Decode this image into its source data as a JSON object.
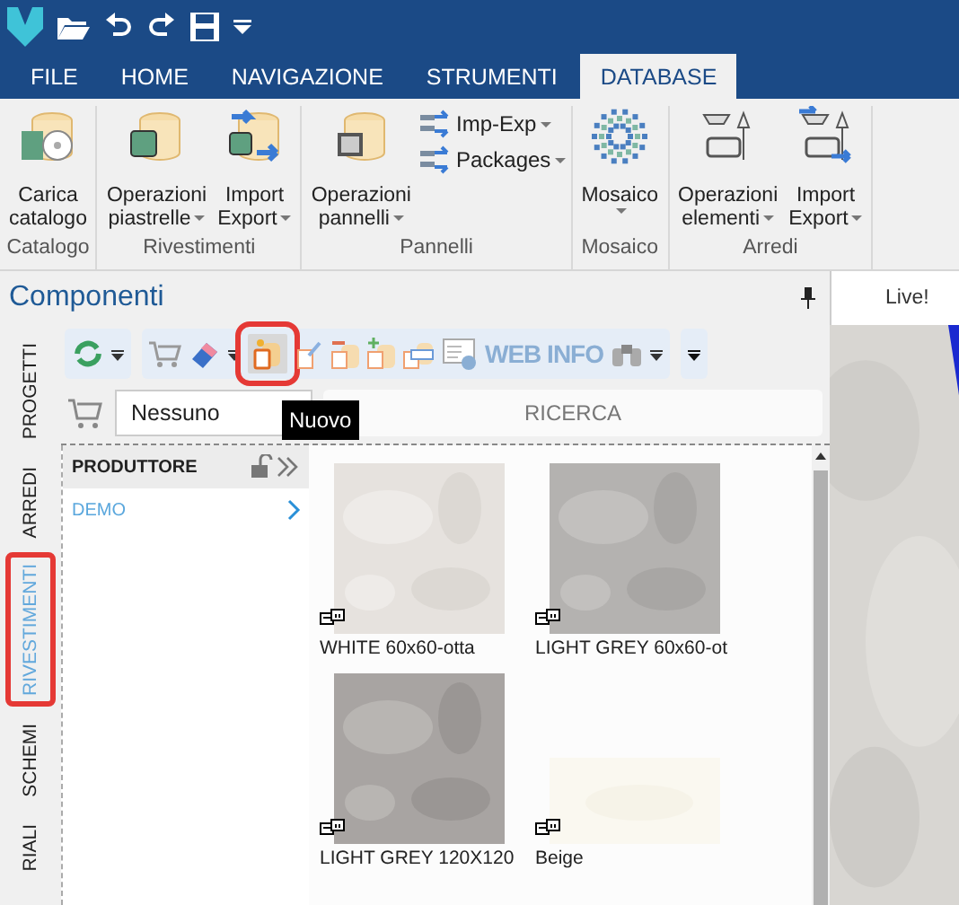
{
  "ribbon_tabs": [
    {
      "label": "FILE",
      "selected": false
    },
    {
      "label": "HOME",
      "selected": false
    },
    {
      "label": "NAVIGAZIONE",
      "selected": false
    },
    {
      "label": "STRUMENTI",
      "selected": false
    },
    {
      "label": "DATABASE",
      "selected": true
    }
  ],
  "ribbon_groups": [
    {
      "label": "Catalogo",
      "items": [
        {
          "kind": "large",
          "lines": [
            "Carica",
            "catalogo"
          ],
          "dropdown": false
        }
      ]
    },
    {
      "label": "Rivestimenti",
      "items": [
        {
          "kind": "large",
          "lines": [
            "Operazioni",
            "piastrelle"
          ],
          "dropdown": true
        },
        {
          "kind": "large",
          "lines": [
            "Import",
            "Export"
          ],
          "dropdown": true
        }
      ]
    },
    {
      "label": "Pannelli",
      "items": [
        {
          "kind": "large",
          "lines": [
            "Operazioni",
            "pannelli"
          ],
          "dropdown": true
        },
        {
          "kind": "small",
          "lines": [
            "Imp-Exp"
          ],
          "dropdown": true
        },
        {
          "kind": "small",
          "lines": [
            "Packages"
          ],
          "dropdown": true
        }
      ]
    },
    {
      "label": "Mosaico",
      "items": [
        {
          "kind": "large",
          "lines": [
            "Mosaico"
          ],
          "dropdown": true
        }
      ]
    },
    {
      "label": "Arredi",
      "items": [
        {
          "kind": "large",
          "lines": [
            "Operazioni",
            "elementi"
          ],
          "dropdown": true
        },
        {
          "kind": "large",
          "lines": [
            "Import",
            "Export"
          ],
          "dropdown": true
        }
      ]
    }
  ],
  "panel": {
    "title": "Componenti",
    "side_tabs": [
      {
        "label": "PROGETTI",
        "selected": false,
        "highlighted": false
      },
      {
        "label": "ARREDI",
        "selected": false,
        "highlighted": false
      },
      {
        "label": "RIVESTIMENTI",
        "selected": true,
        "highlighted": true
      },
      {
        "label": "SCHEMI",
        "selected": false,
        "highlighted": false
      },
      {
        "label": "RIALI",
        "selected": false,
        "highlighted": false
      }
    ],
    "toolbar": {
      "web_info": "WEB INFO",
      "new_button_highlighted": true
    },
    "tooltip": "Nuovo",
    "cart_selection": "Nessuno",
    "search_button": "RICERCA",
    "filter": {
      "header": "PRODUTTORE",
      "items": [
        {
          "label": "DEMO"
        }
      ]
    },
    "tiles": [
      {
        "caption": "WHITE 60x60-otta"
      },
      {
        "caption": "LIGHT GREY 60x60-ot"
      },
      {
        "caption": "LIGHT GREY 120X120"
      },
      {
        "caption": "Beige"
      }
    ]
  },
  "view_tab": "Live!"
}
